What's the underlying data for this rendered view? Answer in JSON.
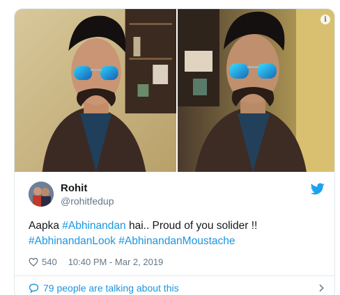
{
  "tweet": {
    "author_name": "Rohit",
    "author_handle": "@rohitfedup",
    "text_segments": [
      {
        "text": "Aapka ",
        "type": "plain"
      },
      {
        "text": "#Abhinandan",
        "type": "hashtag"
      },
      {
        "text": " hai.. Proud of you solider !!",
        "type": "plain"
      },
      {
        "text": "#AbhinandanLook",
        "type": "hashtag"
      },
      {
        "text": " ",
        "type": "plain"
      },
      {
        "text": "#AbhinandanMoustache",
        "type": "hashtag"
      }
    ],
    "like_count": "540",
    "timestamp": "10:40 PM - Mar 2, 2019",
    "conversation_link": "79 people are talking about this"
  },
  "icons": {
    "info": "info-icon",
    "brand": "twitter-bird-icon",
    "like": "heart-icon",
    "reply": "speech-bubble-icon",
    "expand": "chevron-right-icon"
  },
  "colors": {
    "hashtag": "#1b95e0",
    "secondary_text": "#657786",
    "border": "#e1e8ed",
    "primary_text": "#14171a"
  }
}
